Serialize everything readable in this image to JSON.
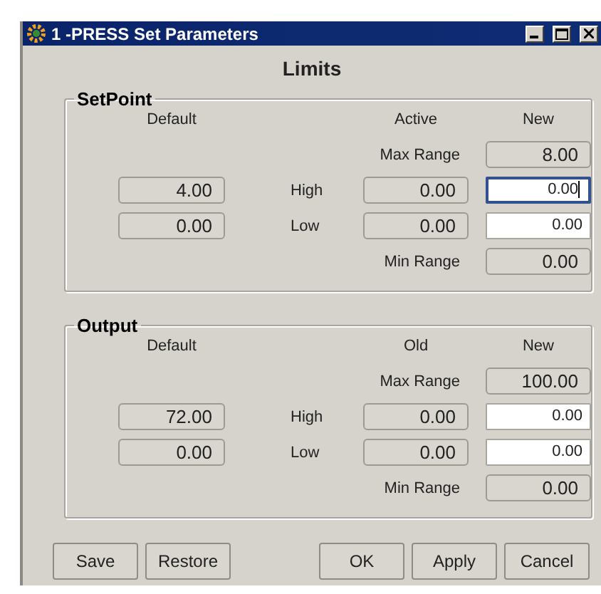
{
  "window": {
    "title": "1 -PRESS Set Parameters"
  },
  "heading": "Limits",
  "groups": [
    {
      "title": "SetPoint",
      "headers": {
        "default": "Default",
        "current": "Active",
        "new": "New"
      },
      "max_range": {
        "label": "Max Range",
        "value": "8.00"
      },
      "rows": [
        {
          "label": "High",
          "default": "4.00",
          "current": "0.00",
          "new": "0.00",
          "focused": true
        },
        {
          "label": "Low",
          "default": "0.00",
          "current": "0.00",
          "new": "0.00",
          "focused": false
        }
      ],
      "min_range": {
        "label": "Min Range",
        "value": "0.00"
      }
    },
    {
      "title": "Output",
      "headers": {
        "default": "Default",
        "current": "Old",
        "new": "New"
      },
      "max_range": {
        "label": "Max Range",
        "value": "100.00"
      },
      "rows": [
        {
          "label": "High",
          "default": "72.00",
          "current": "0.00",
          "new": "0.00",
          "focused": false
        },
        {
          "label": "Low",
          "default": "0.00",
          "current": "0.00",
          "new": "0.00",
          "focused": false
        }
      ],
      "min_range": {
        "label": "Min Range",
        "value": "0.00"
      }
    }
  ],
  "buttons_left": [
    "Save",
    "Restore"
  ],
  "buttons_right": [
    "OK",
    "Apply",
    "Cancel"
  ]
}
